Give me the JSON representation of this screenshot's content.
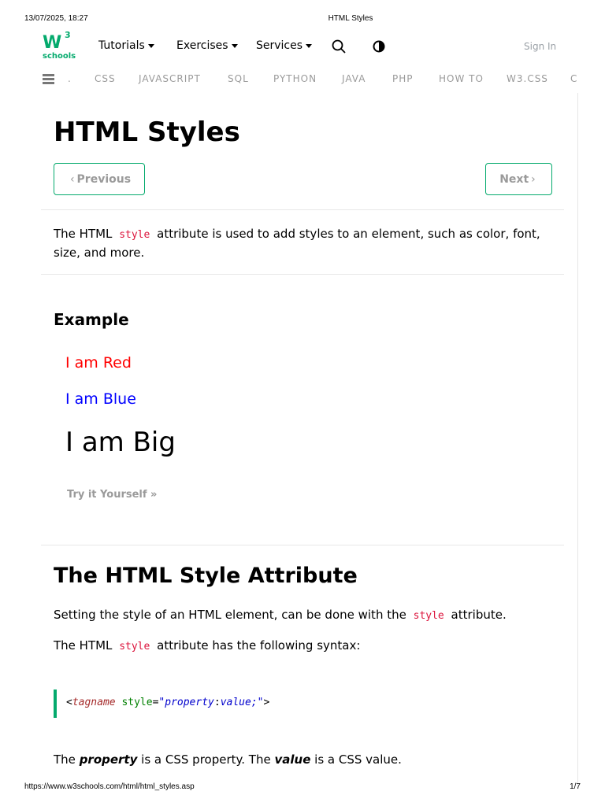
{
  "print_header": {
    "datetime": "13/07/2025, 18:27",
    "title": "HTML Styles"
  },
  "print_footer": {
    "url": "https://www.w3schools.com/html/html_styles.asp",
    "page": "1/7"
  },
  "logo": {
    "mark": "W",
    "sup": "3",
    "word": "schools"
  },
  "topnav": {
    "tutorials": "Tutorials",
    "exercises": "Exercises",
    "services": "Services",
    "sign_in": "Sign In"
  },
  "subnav": {
    "items": ".",
    "css": "CSS",
    "javascript": "JAVASCRIPT",
    "sql": "SQL",
    "python": "PYTHON",
    "java": "JAVA",
    "php": "PHP",
    "howto": "HOW TO",
    "w3css": "W3.CSS",
    "more": "C"
  },
  "page": {
    "title": "HTML Styles",
    "prev": "Previous",
    "next": "Next",
    "intro_a": "The HTML",
    "intro_code": "style",
    "intro_b": "attribute is used to add styles to an element, such as color, font, size, and more."
  },
  "example": {
    "heading": "Example",
    "red": "I am Red",
    "blue": "I am Blue",
    "big": "I am Big",
    "try": "Try it Yourself »"
  },
  "section2": {
    "heading": "The HTML Style Attribute",
    "p1_a": "Setting the style of an HTML element, can be done with the",
    "p1_code": "style",
    "p1_b": "attribute.",
    "p2_a": "The HTML",
    "p2_code": "style",
    "p2_b": "attribute has the following syntax:",
    "code": {
      "lt": "<",
      "tag": "tagname",
      "attr": " style",
      "eq": "=",
      "q1": "\"",
      "prop": "property",
      "colon": ":",
      "val": "value;",
      "q2": "\"",
      "gt": ">"
    },
    "p3_a": "The",
    "p3_prop": "property",
    "p3_b": "is a CSS property. The",
    "p3_val": "value",
    "p3_c": "is a CSS value."
  },
  "colors": {
    "accent": "#04AA6D",
    "code_keyword": "#dc143c",
    "red": "#ff0000",
    "blue": "#0000ff"
  }
}
